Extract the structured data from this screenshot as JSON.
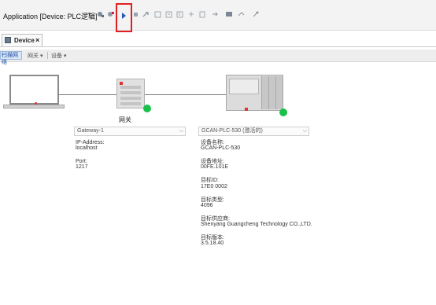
{
  "toolbar": {
    "application_label": "Application [Device: PLC逻辑]",
    "dropdown_arrow": "▾",
    "run_tooltip": "Run"
  },
  "tabs": [
    {
      "label": "Device",
      "close": "×"
    }
  ],
  "subtoolbar": {
    "scan": "扫描网络",
    "gateway": "网关",
    "device": "设备",
    "arrow": "▾"
  },
  "network": {
    "gateway_label": "网关",
    "gateway_dropdown": "Gateway-1",
    "device_dropdown": "GCAN-PLC-530 (激活的)",
    "dropdown_arrow": "⌵",
    "status_color": "#19c14a"
  },
  "gateway_info": {
    "ip_label": "IP-Address:",
    "ip_value": "localhost",
    "port_label": "Port:",
    "port_value": "1217"
  },
  "device_info": {
    "name_label": "设备名称:",
    "name_value": "GCAN-PLC-530",
    "address_label": "设备地址:",
    "address_value": "00FE.101E",
    "target_id_label": "目标ID:",
    "target_id_value": "17E0 0002",
    "target_type_label": "目标类型:",
    "target_type_value": "4096",
    "vendor_label": "目标供应商:",
    "vendor_value": "Shenyang Guangcheng Technology CO.,LTD.",
    "version_label": "目标版本:",
    "version_value": "3.5.18.40"
  }
}
